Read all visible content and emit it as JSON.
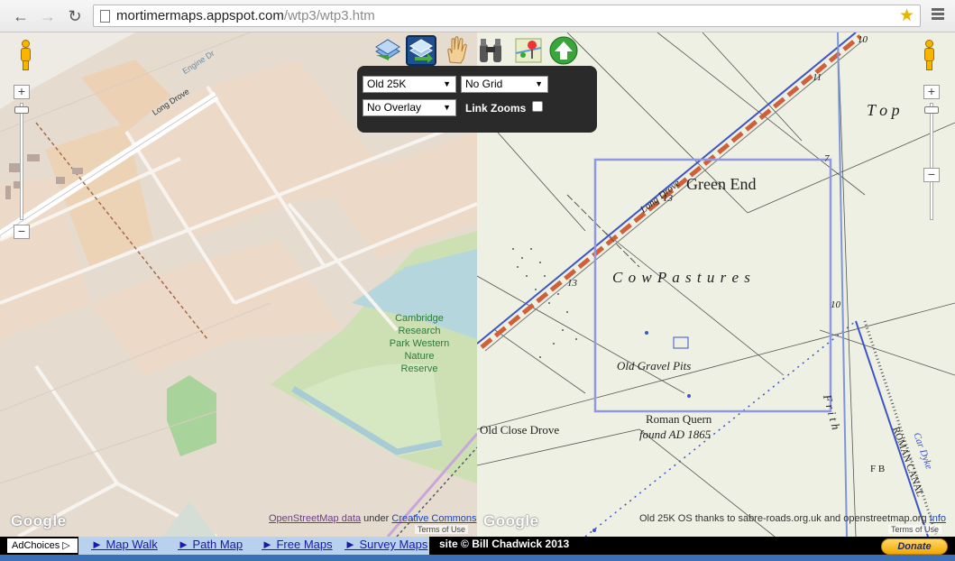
{
  "browser": {
    "url_host": "mortimermaps.appspot.com",
    "url_path": "/wtp3/wtp3.htm",
    "icons": [
      "back-icon",
      "forward-icon",
      "reload-icon",
      "page-icon",
      "star-icon",
      "menu-icon"
    ]
  },
  "toolbar": {
    "icons": [
      "map-layers-icon",
      "sync-maps-icon",
      "hand-pan-icon",
      "binoculars-icon",
      "map-marker-icon",
      "up-arrow-icon"
    ]
  },
  "panel": {
    "map_select": "Old 25K",
    "grid_select": "No Grid",
    "overlay_select": "No Overlay",
    "link_zooms_label": "Link Zooms",
    "link_zooms_checked": false
  },
  "left_map": {
    "labels": {
      "long_drove": "Long Drove",
      "engine_dr": "Engine Dr",
      "reserve_l1": "Cambridge",
      "reserve_l2": "Research",
      "reserve_l3": "Park Western",
      "reserve_l4": "Nature",
      "reserve_l5": "Reserve"
    },
    "google": "Google",
    "attribution_link1": "OpenStreetMap data",
    "attribution_mid": " under ",
    "attribution_link2": "Creative Commons",
    "terms": "Terms of Use"
  },
  "right_map": {
    "labels": {
      "top": "T o p",
      "green_end": "Green  End",
      "long_drove": "Long Drove",
      "cow_pastures": "C o w        P a s t u r e s",
      "old_gravel_pits": "Old Gravel Pits",
      "roman_quern": "Roman Quern",
      "found": "found AD 1865",
      "old_close_drove": "Old Close Drove",
      "frith": "F r i t h",
      "roman_canal": "ROMAN CANAL",
      "car_dyke": "Car Dyke",
      "fb": "F B",
      "n13a": "13",
      "n13b": "13",
      "n10a": "10",
      "n10b": "10",
      "n11": "11",
      "n7": "7"
    },
    "google": "Google",
    "attribution": "Old 25K OS thanks to sabre-roads.org.uk and openstreetmap.org",
    "attribution_link": "Info",
    "terms": "Terms of Use"
  },
  "footer": {
    "adchoices": "AdChoices",
    "links": [
      "► Map Walk",
      "► Path Map",
      "► Free Maps",
      "► Survey Maps"
    ],
    "copyright": "site © Bill Chadwick 2013",
    "donate": "Donate"
  }
}
